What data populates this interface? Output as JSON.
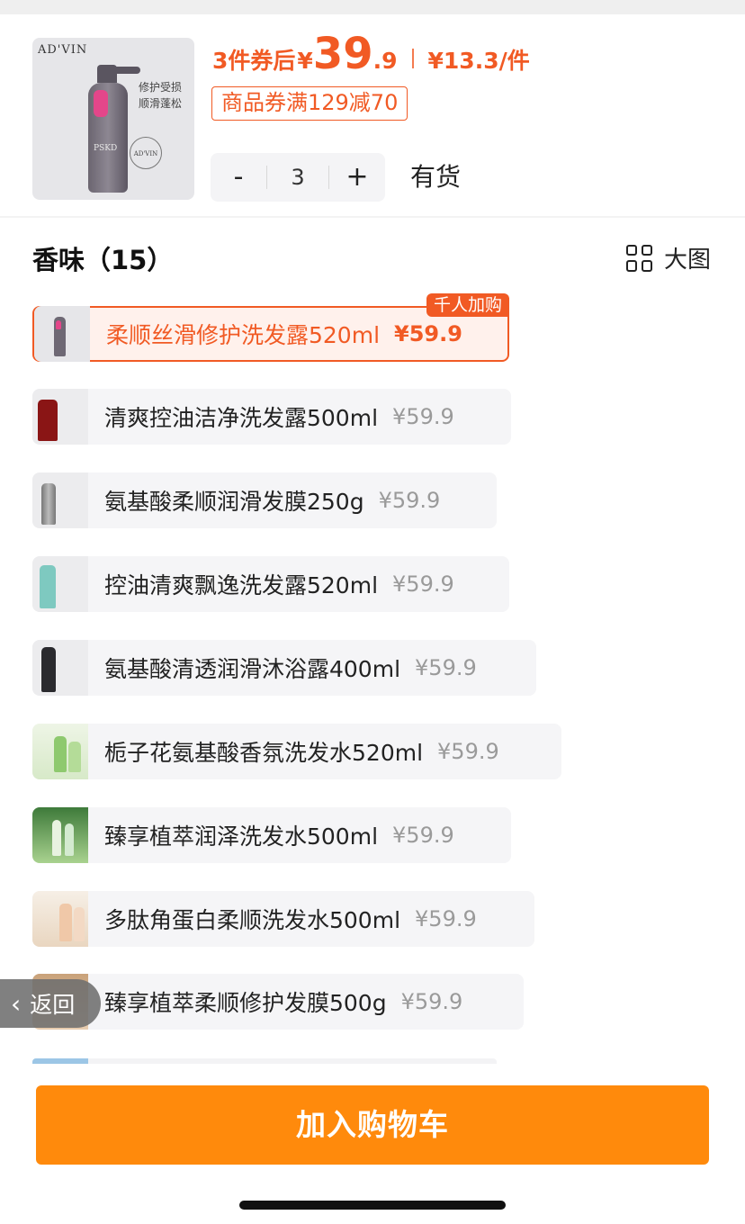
{
  "product": {
    "brand": "AD'VIN",
    "thumb_text_line1": "修护受损",
    "thumb_text_line2": "顺滑蓬松",
    "bottle_label": "PSKD",
    "seal_text": "AD'VIN",
    "coupon_prefix": "3件券后",
    "price_symbol": "¥",
    "price_integer": "39",
    "price_decimal": ".9",
    "per_item": "¥13.3/件",
    "coupon_label": "商品券满129减70",
    "quantity": "3",
    "minus": "-",
    "plus": "+",
    "stock_status": "有货"
  },
  "section": {
    "title": "香味（15）",
    "view_toggle_label": "大图"
  },
  "variants": [
    {
      "name": "柔顺丝滑修护洗发露520ml",
      "price": "¥59.9",
      "selected": true,
      "badge": "千人加购"
    },
    {
      "name": "清爽控油洁净洗发露500ml",
      "price": "¥59.9"
    },
    {
      "name": "氨基酸柔顺润滑发膜250g",
      "price": "¥59.9"
    },
    {
      "name": "控油清爽飘逸洗发露520ml",
      "price": "¥59.9"
    },
    {
      "name": "氨基酸清透润滑沐浴露400ml",
      "price": "¥59.9"
    },
    {
      "name": "栀子花氨基酸香氛洗发水520ml",
      "price": "¥59.9"
    },
    {
      "name": "臻享植萃润泽洗发水500ml",
      "price": "¥59.9"
    },
    {
      "name": "多肽角蛋白柔顺洗发水500ml",
      "price": "¥59.9"
    },
    {
      "name": "臻享植萃柔顺修护发膜500g",
      "price": "¥59.9"
    }
  ],
  "back_button": {
    "chevron": "‹",
    "label": "返回"
  },
  "add_to_cart_label": "加入购物车",
  "colors": {
    "accent": "#f15a24",
    "cart_button": "#ff8a0c"
  }
}
